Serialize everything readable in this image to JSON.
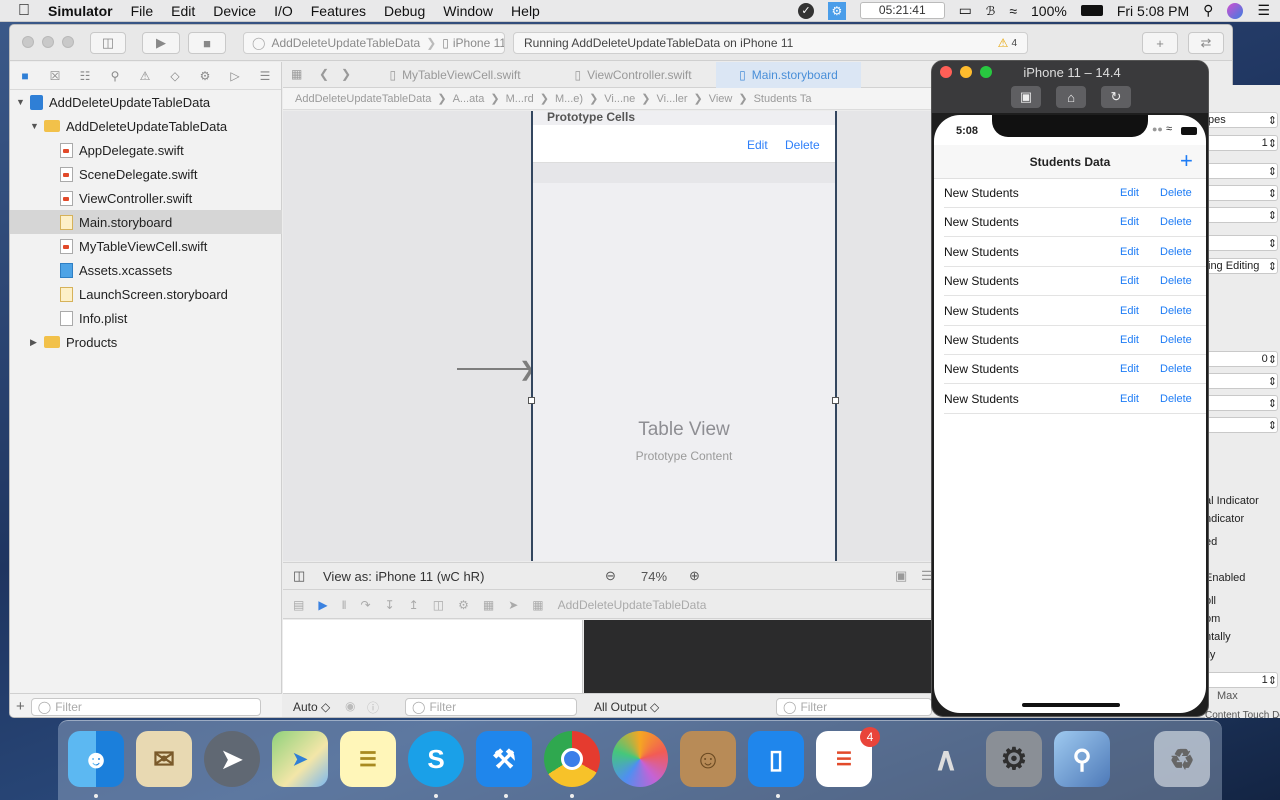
{
  "menubar": {
    "app": "Simulator",
    "items": [
      "File",
      "Edit",
      "Device",
      "I/O",
      "Features",
      "Debug",
      "Window",
      "Help"
    ],
    "clock": "05:21:41",
    "battery": "100%",
    "datetime": "Fri 5:08 PM"
  },
  "toolbar": {
    "scheme_project": "AddDeleteUpdateTableData",
    "scheme_device": "iPhone 11",
    "status": "Running AddDeleteUpdateTableData on iPhone 11",
    "warnings": "4"
  },
  "navigator": {
    "project": "AddDeleteUpdateTableData",
    "group": "AddDeleteUpdateTableData",
    "files": [
      {
        "name": "AppDelegate.swift",
        "type": "swift"
      },
      {
        "name": "SceneDelegate.swift",
        "type": "swift"
      },
      {
        "name": "ViewController.swift",
        "type": "swift"
      },
      {
        "name": "Main.storyboard",
        "type": "sb",
        "selected": true
      },
      {
        "name": "MyTableViewCell.swift",
        "type": "swift"
      },
      {
        "name": "Assets.xcassets",
        "type": "asset"
      },
      {
        "name": "LaunchScreen.storyboard",
        "type": "sb"
      },
      {
        "name": "Info.plist",
        "type": "plist"
      }
    ],
    "products": "Products",
    "filter_placeholder": "Filter"
  },
  "editor": {
    "tabs": [
      "MyTableViewCell.swift",
      "ViewController.swift",
      "Main.storyboard"
    ],
    "jumpbar": [
      "AddDeleteUpdateTableData",
      "A...ata",
      "M...rd",
      "M...e)",
      "Vi...ne",
      "Vi...ler",
      "View",
      "Students Ta"
    ],
    "prototype_header": "Prototype Cells",
    "cell_edit": "Edit",
    "cell_delete": "Delete",
    "tableview_label": "Table View",
    "tableview_sub": "Prototype Content",
    "view_as": "View as: iPhone 11 (",
    "view_as_c": "wC",
    "view_as_r": "hR)",
    "zoom": "74%",
    "debug_target": "AddDeleteUpdateTableData",
    "vars_scope": "Auto ◇",
    "console_output": "All Output ◇",
    "filter_placeholder": "Filter"
  },
  "inspector": {
    "items": [
      "pes",
      "1",
      "",
      "",
      "",
      "",
      "ing Editing",
      "",
      "0",
      "",
      "",
      "",
      "al Indicator",
      "ndicator",
      "ed",
      ")",
      "Enabled",
      "oll",
      "om",
      "ntally",
      "lly",
      "1",
      "Max",
      "Content Touch  Delay Touch Down"
    ]
  },
  "simulator": {
    "title": "iPhone 11 – 14.4",
    "time": "5:08",
    "nav_title": "Students Data",
    "add_label": "+",
    "rows": [
      {
        "name": "New Students",
        "edit": "Edit",
        "delete": "Delete"
      },
      {
        "name": "New Students",
        "edit": "Edit",
        "delete": "Delete"
      },
      {
        "name": "New Students",
        "edit": "Edit",
        "delete": "Delete"
      },
      {
        "name": "New Students",
        "edit": "Edit",
        "delete": "Delete"
      },
      {
        "name": "New Students",
        "edit": "Edit",
        "delete": "Delete"
      },
      {
        "name": "New Students",
        "edit": "Edit",
        "delete": "Delete"
      },
      {
        "name": "New Students",
        "edit": "Edit",
        "delete": "Delete"
      },
      {
        "name": "New Students",
        "edit": "Edit",
        "delete": "Delete"
      }
    ]
  },
  "dock": {
    "apps": [
      "Finder",
      "Mail",
      "Launchpad",
      "Maps",
      "Notes",
      "Skype",
      "Xcode",
      "Chrome",
      "Photos",
      "Contacts",
      "Simulator",
      "Reminders",
      "Instruments",
      "System Preferences",
      "Preview",
      "Trash"
    ],
    "reminders_badge": "4"
  },
  "colors": {
    "accent": "#2d7ff9",
    "scene_border": "#33465f",
    "badge": "#e9443a"
  }
}
